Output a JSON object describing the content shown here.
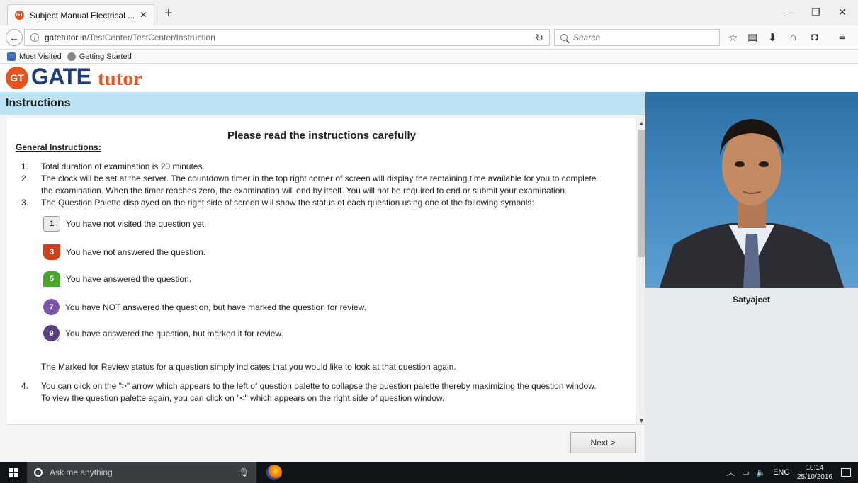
{
  "browser": {
    "tab_title": "Subject Manual Electrical ...",
    "tab_favicon": "GT",
    "url_host": "gatetutor.in",
    "url_path": "/TestCenter/TestCenter/Instruction",
    "search_placeholder": "Search",
    "bookmarks": [
      "Most Visited",
      "Getting Started"
    ]
  },
  "header": {
    "logo_badge": "GT",
    "logo_gate": "GATE",
    "logo_tutor": "tutor",
    "section_title": "Instructions"
  },
  "instructions": {
    "title": "Please read the instructions carefully",
    "general_heading": "General Instructions:",
    "item1": "Total duration of examination is 20 minutes.",
    "item2a": "The clock will be set at the server. The countdown timer in the top right corner of screen will display the remaining time available for you to complete",
    "item2b": "the examination. When the timer reaches zero, the examination will end by itself. You will not be required to end or submit your examination.",
    "item3": "The Question Palette displayed on the right side of screen will show the status of each question using one of the following symbols:",
    "symbols": [
      {
        "num": "1",
        "text": "You have not visited the question yet."
      },
      {
        "num": "3",
        "text": "You have not answered the question."
      },
      {
        "num": "5",
        "text": "You have answered the question."
      },
      {
        "num": "7",
        "text": "You have NOT answered the question, but have marked the question for review."
      },
      {
        "num": "9",
        "text": "You have answered the question, but marked it for review."
      }
    ],
    "review_note": "The Marked for Review status for a question simply indicates that you would like to look at that question again.",
    "item4a": "You can click on the \">\" arrow which appears to the left of question palette to collapse the question palette thereby maximizing the question window.",
    "item4b": "To view the question palette again, you can click on \"<\" which appears on the right side of question window.",
    "next_label": "Next >"
  },
  "candidate": {
    "name": "Satyajeet"
  },
  "taskbar": {
    "search_placeholder": "Ask me anything",
    "lang": "ENG",
    "time": "18:14",
    "date": "25/10/2016"
  }
}
